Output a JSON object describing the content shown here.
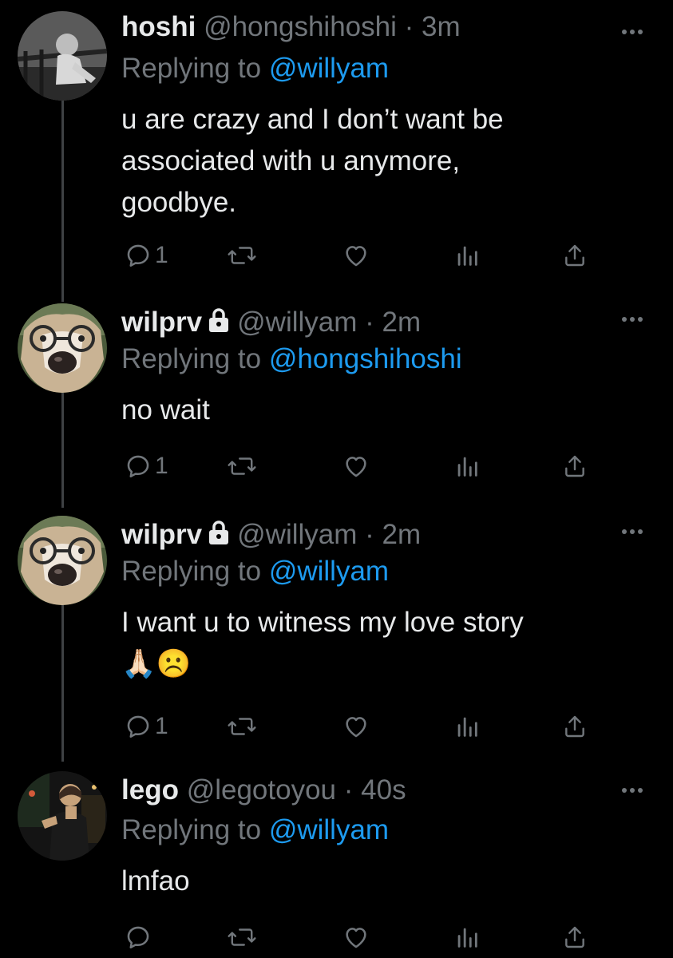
{
  "tweets": [
    {
      "name": "hoshi",
      "handle": "@hongshihoshi",
      "dot": "·",
      "time": "3m",
      "protected": false,
      "replying_prefix": "Replying to ",
      "replying_to": "@willyam",
      "text": "u are crazy and I don’t want be\nassociated with u anymore,\ngoodbye.",
      "reply_count": "1"
    },
    {
      "name": "wilprv",
      "handle": "@willyam",
      "dot": "·",
      "time": "2m",
      "protected": true,
      "replying_prefix": "Replying to ",
      "replying_to": "@hongshihoshi",
      "text": "no wait",
      "reply_count": "1"
    },
    {
      "name": "wilprv",
      "handle": "@willyam",
      "dot": "·",
      "time": "2m",
      "protected": true,
      "replying_prefix": "Replying to ",
      "replying_to": "@willyam",
      "text": "I want u to witness my love story\n🙏🏻☹️",
      "reply_count": "1"
    },
    {
      "name": "lego",
      "handle": "@legotoyou",
      "dot": "·",
      "time": "40s",
      "protected": false,
      "replying_prefix": "Replying to ",
      "replying_to": "@willyam",
      "text": "lmfao",
      "reply_count": ""
    }
  ],
  "icons": {
    "reply": "reply-icon",
    "retweet": "retweet-icon",
    "like": "heart-icon",
    "views": "views-icon",
    "share": "share-icon",
    "more": "more-icon",
    "lock": "lock-icon"
  },
  "colors": {
    "background": "#000000",
    "text": "#e7e9ea",
    "muted": "#71767b",
    "link": "#1d9bf0",
    "thread_line": "#3e4144"
  }
}
